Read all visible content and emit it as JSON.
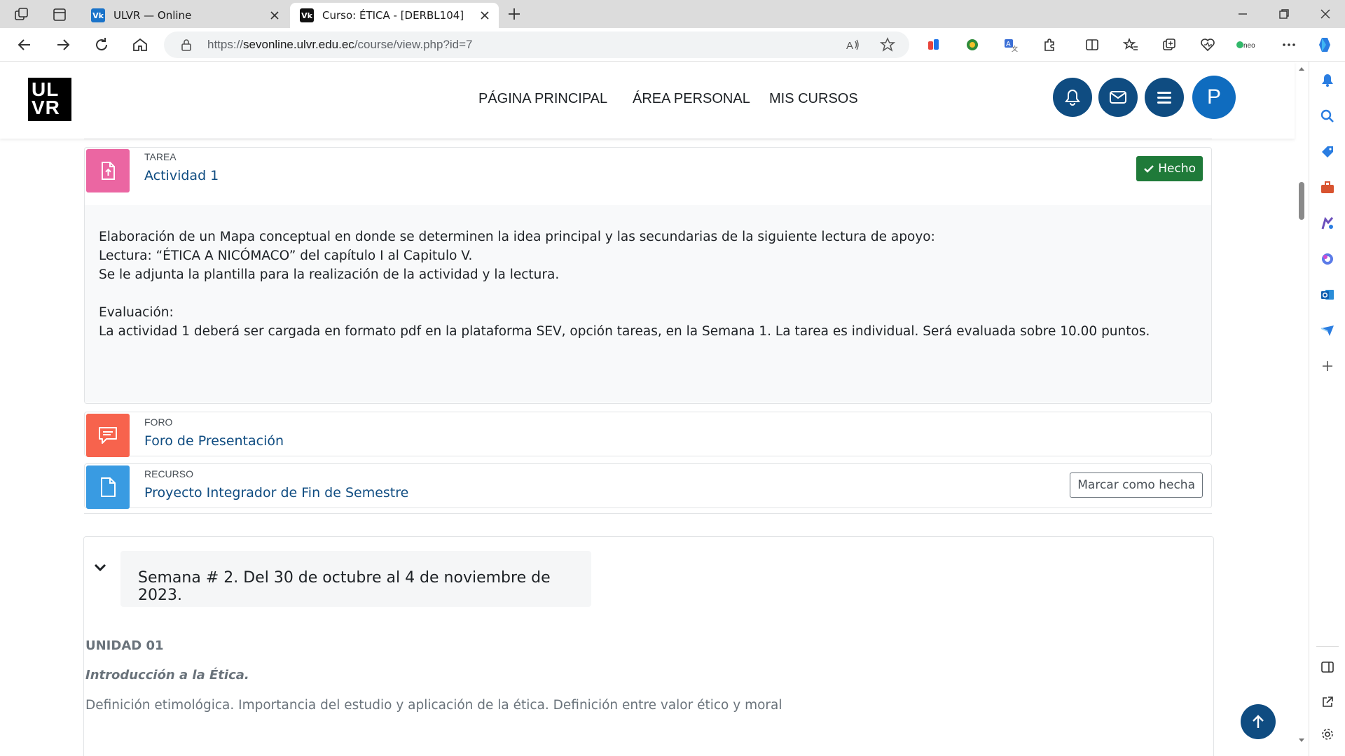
{
  "browser": {
    "tabs": [
      {
        "title": "ULVR — Online",
        "active": false
      },
      {
        "title": "Curso: ÉTICA - [DERBL104]",
        "active": true
      }
    ],
    "address": {
      "prefix": "https://",
      "domain": "sevonline.ulvr.edu.ec",
      "path": "/course/view.php?id=7"
    }
  },
  "site": {
    "logo_top": "UL",
    "logo_bottom": "VR",
    "nav": [
      "PÁGINA PRINCIPAL",
      "ÁREA PERSONAL",
      "MIS CURSOS"
    ],
    "avatar_initial": "P"
  },
  "activities": {
    "tarea": {
      "type": "TAREA",
      "name": "Actividad 1",
      "status": "Hecho",
      "description": [
        "Elaboración de un Mapa conceptual en donde se determinen la idea principal y las secundarias de la siguiente lectura de apoyo:",
        "Lectura: “ÉTICA A NICÓMACO” del capítulo I al Capitulo V.",
        "Se le adjunta la plantilla para la realización de la actividad y la lectura.",
        "",
        "Evaluación:",
        "La actividad 1 deberá ser cargada en formato pdf en la plataforma SEV, opción tareas, en la Semana 1. La tarea es individual. Será evaluada sobre 10.00 puntos."
      ]
    },
    "foro": {
      "type": "FORO",
      "name": "Foro de Presentación"
    },
    "recurso": {
      "type": "RECURSO",
      "name": "Proyecto Integrador de Fin de Semestre",
      "button": "Marcar como hecha"
    }
  },
  "week2": {
    "title": "Semana # 2. Del 30 de octubre al 4 de noviembre de 2023.",
    "unit": "UNIDAD 01",
    "subtitle": "Introducción a la Ética.",
    "text": "Definición etimológica. Importancia del estudio y aplicación de la ética. Definición entre valor ético y moral"
  },
  "colors": {
    "nav_blue": "#0f4c81",
    "assign_pink": "#eb66a2",
    "forum_red": "#f7634d",
    "resource_blue": "#399be2",
    "done_green": "#1f7a39"
  }
}
